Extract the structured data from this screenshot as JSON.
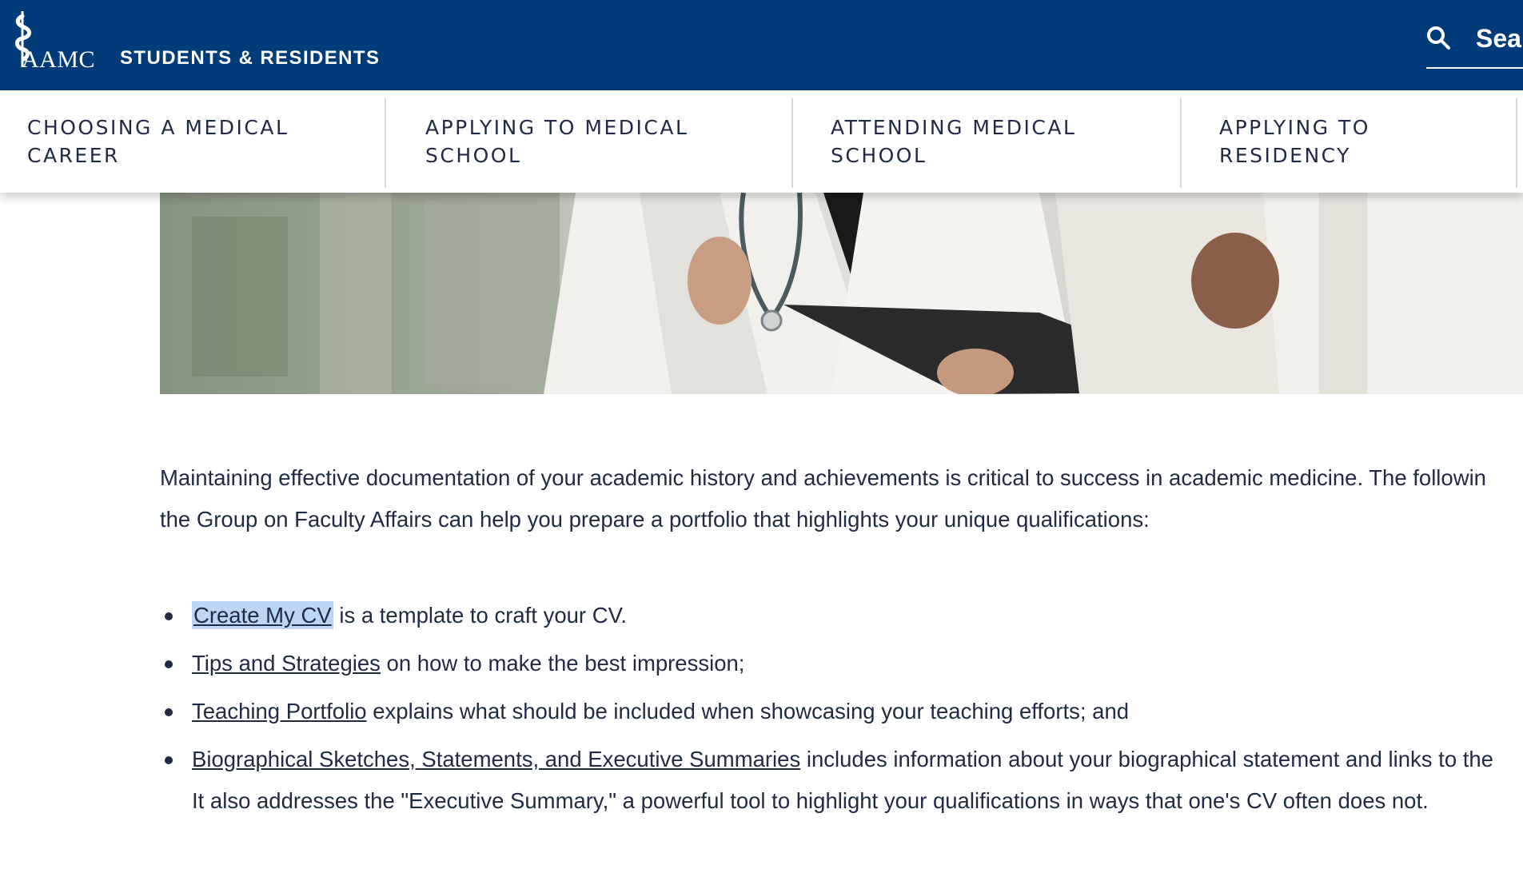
{
  "header": {
    "logo_text": "AAMC",
    "site_title": "STUDENTS & RESIDENTS",
    "search_label": "Sea"
  },
  "nav": {
    "items": [
      {
        "label": "CHOOSING A MEDICAL\nCAREER"
      },
      {
        "label": "APPLYING TO MEDICAL\nSCHOOL"
      },
      {
        "label": "ATTENDING MEDICAL\nSCHOOL"
      },
      {
        "label": "APPLYING TO\nRESIDENCY"
      }
    ]
  },
  "content": {
    "intro_line1": "Maintaining effective documentation of your academic history and achievements is critical to success in academic medicine. The followin",
    "intro_line2": "the Group on Faculty Affairs can help you prepare a portfolio that highlights your unique qualifications:",
    "bullets": [
      {
        "link": "Create My CV",
        "text": " is a template to craft your CV."
      },
      {
        "link": "Tips and Strategies",
        "text": " on how to make the best impression;"
      },
      {
        "link": "Teaching Portfolio",
        "text": " explains what should be included when showcasing your teaching efforts; and"
      },
      {
        "link": "Biographical Sketches, Statements, and Executive Summaries",
        "text": " includes information about your biographical statement and links to the",
        "text2": "It also addresses the \"Executive Summary,\" a powerful tool to highlight your qualifications in ways that one's CV often does not."
      }
    ]
  },
  "colors": {
    "header_bg": "#003b7a",
    "text": "#1f2a44",
    "link_selection": "#bcd5f5"
  }
}
